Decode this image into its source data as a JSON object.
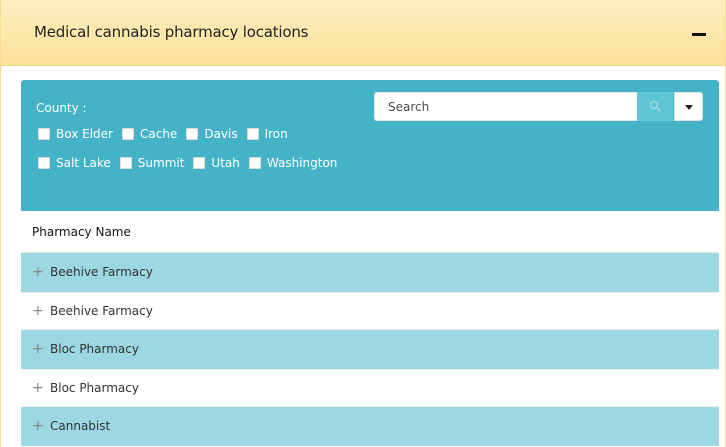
{
  "panel": {
    "title": "Medical cannabis pharmacy locations",
    "collapse_symbol": "minus-icon"
  },
  "filter": {
    "county_label": "County :",
    "row1": [
      "Box Elder",
      "Cache",
      "Davis",
      "Iron"
    ],
    "row2": [
      "Salt Lake",
      "Summit",
      "Utah",
      "Washington"
    ],
    "search_placeholder": "Search"
  },
  "table": {
    "header": "Pharmacy Name",
    "rows": [
      "Beehive Farmacy",
      "Beehive Farmacy",
      "Bloc Pharmacy",
      "Bloc Pharmacy",
      "Cannabist"
    ],
    "expand_icon": "+"
  },
  "colors": {
    "header_bg": "#fbe29a",
    "filter_bg": "#45b3c7",
    "row_alt_bg": "#9bd8e3"
  }
}
